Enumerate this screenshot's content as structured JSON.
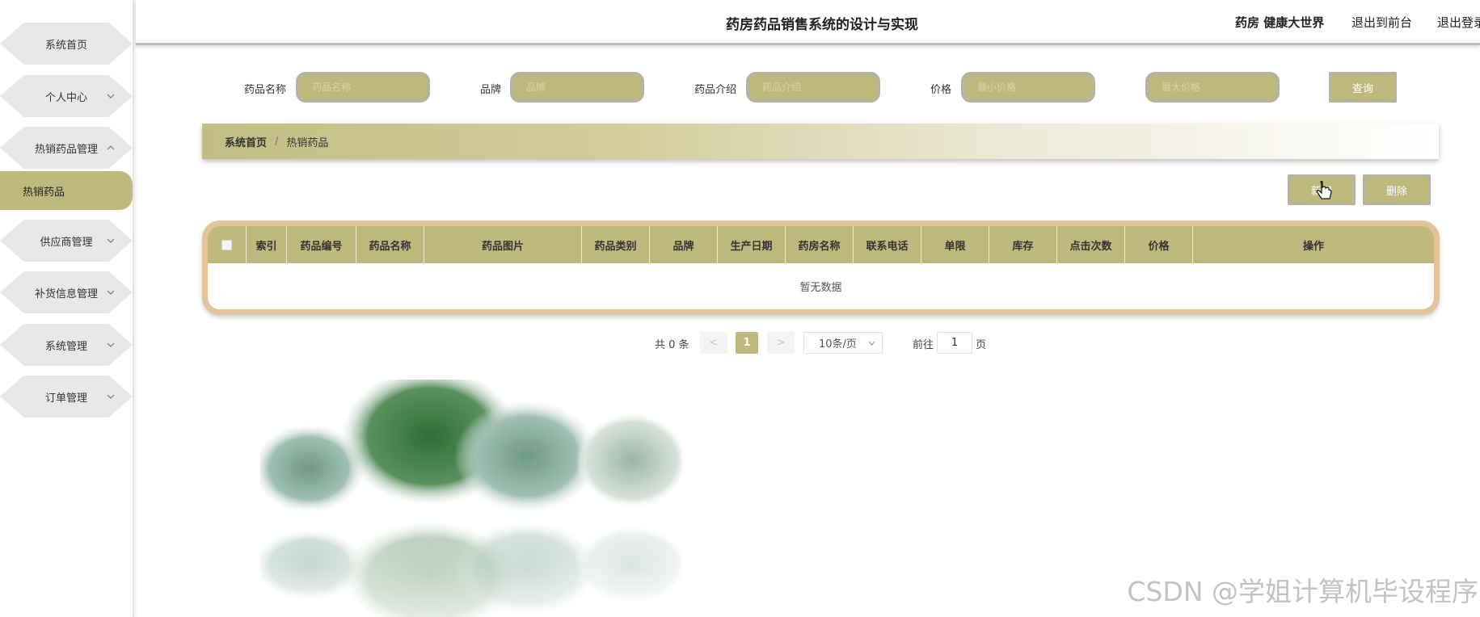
{
  "sidebar": {
    "items": [
      {
        "label": "系统首页",
        "expandable": false
      },
      {
        "label": "个人中心",
        "expandable": true
      },
      {
        "label": "热销药品管理",
        "expandable": true,
        "expanded": true
      },
      {
        "label": "供应商管理",
        "expandable": true
      },
      {
        "label": "补货信息管理",
        "expandable": true
      },
      {
        "label": "系统管理",
        "expandable": true
      },
      {
        "label": "订单管理",
        "expandable": true
      }
    ],
    "active_sub_item": "热销药品"
  },
  "header": {
    "title": "药房药品销售系统的设计与实现",
    "user": "药房 健康大世界",
    "back_to_front": "退出到前台",
    "logout": "退出登录"
  },
  "search": {
    "name_label": "药品名称",
    "name_placeholder": "药品名称",
    "brand_label": "品牌",
    "brand_placeholder": "品牌",
    "intro_label": "药品介绍",
    "intro_placeholder": "药品介绍",
    "price_label": "价格",
    "min_price_placeholder": "最小价格",
    "max_price_placeholder": "最大价格",
    "query_button": "查询"
  },
  "breadcrumb": {
    "home": "系统首页",
    "separator": "/",
    "current": "热销药品"
  },
  "actions": {
    "add_button": "新增",
    "delete_button": "删除"
  },
  "table": {
    "columns": [
      "索引",
      "药品编号",
      "药品名称",
      "药品图片",
      "药品类别",
      "品牌",
      "生产日期",
      "药房名称",
      "联系电话",
      "单限",
      "库存",
      "点击次数",
      "价格",
      "操作"
    ],
    "empty_text": "暂无数据"
  },
  "pagination": {
    "total_text": "共 0 条",
    "prev": "<",
    "current_page": "1",
    "next": ">",
    "page_size": "10条/页",
    "goto_label": "前往",
    "goto_value": "1",
    "page_suffix": "页"
  },
  "watermark": "CSDN @学姐计算机毕设程序",
  "colors": {
    "accent": "#c0b97e",
    "table_border": "#e3c49a",
    "menu_bg": "#e8e8e8"
  }
}
